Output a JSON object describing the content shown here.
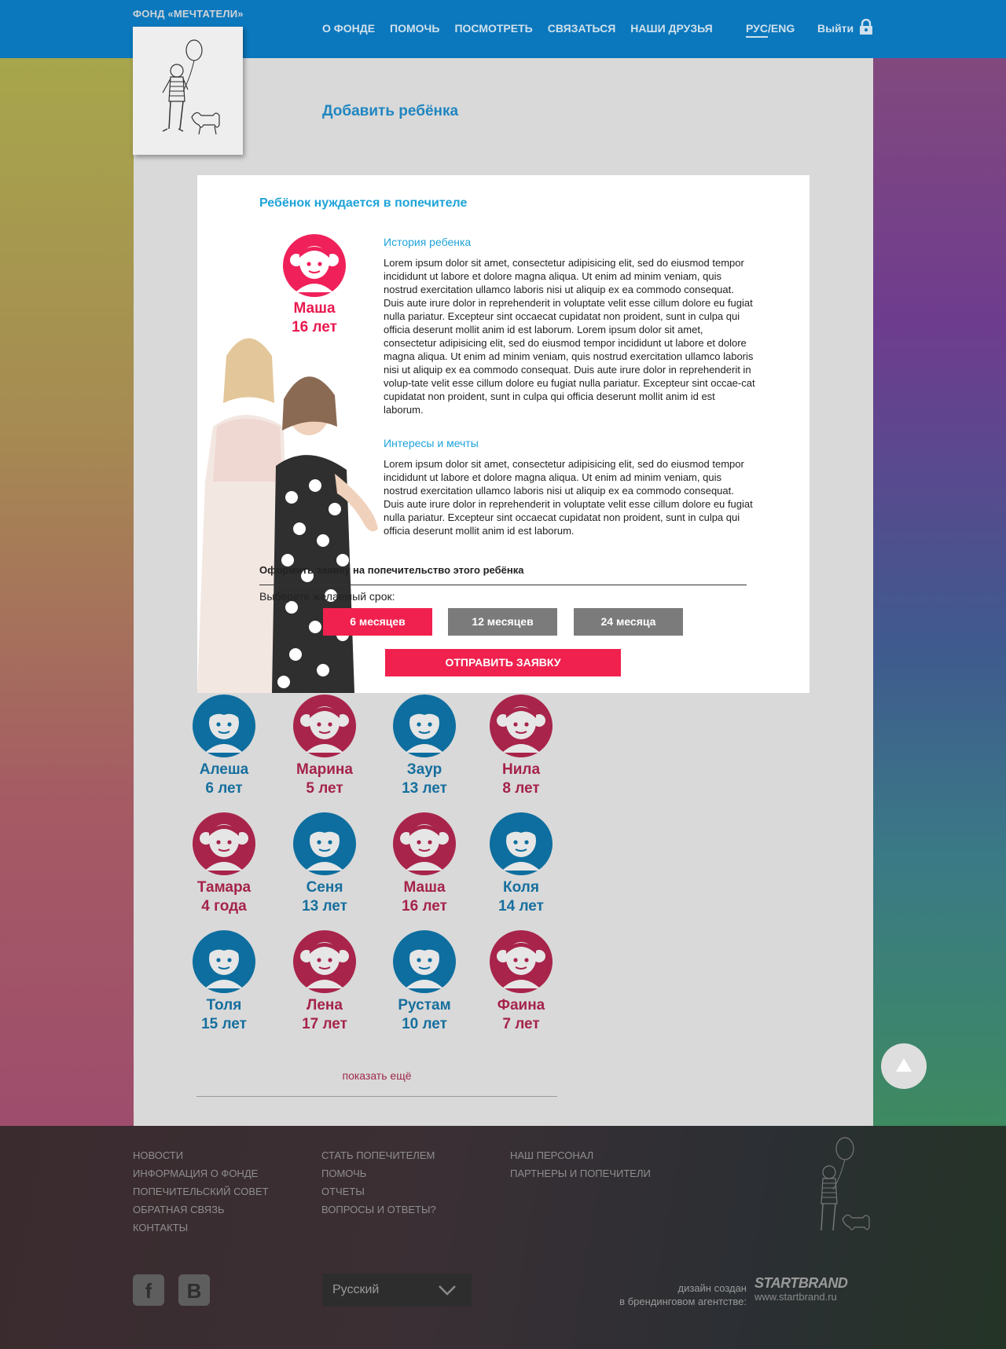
{
  "header": {
    "brand": "ФОНД «МЕЧТАТЕЛИ»",
    "nav": [
      "О ФОНДЕ",
      "ПОМОЧЬ",
      "ПОСМОТРЕТЬ",
      "СВЯЗАТЬСЯ",
      "НАШИ ДРУЗЬЯ"
    ],
    "lang_ru": "РУС",
    "lang_sep": "/",
    "lang_en": "ENG",
    "logout": "Выйти"
  },
  "page": {
    "title": "Добавить ребёнка"
  },
  "modal": {
    "title": "Ребёнок нуждается в попечителе",
    "child_name": "Маша",
    "child_age": "16 лет",
    "history_title": "История ребенка",
    "history_text": "Lorem ipsum dolor sit amet, consectetur adipisicing elit, sed do eiusmod tempor incididunt ut labore et dolore magna aliqua. Ut enim ad minim veniam, quis nostrud exercitation ullamco laboris nisi ut aliquip ex ea commodo consequat. Duis aute irure dolor in reprehenderit in voluptate velit esse cillum dolore eu fugiat nulla pariatur. Excepteur sint occaecat cupidatat non proident, sunt in culpa qui officia deserunt mollit anim id est laborum. Lorem ipsum dolor sit amet, consectetur adipisicing elit, sed do eiusmod tempor incididunt ut labore et dolore magna aliqua. Ut enim ad minim veniam, quis nostrud exercitation ullamco laboris nisi ut aliquip ex ea commodo consequat. Duis aute irure dolor in reprehenderit in volup-tate velit esse cillum dolore eu fugiat nulla pariatur. Excepteur sint occae-cat cupidatat non proident, sunt in culpa qui officia deserunt mollit anim id est laborum.",
    "dreams_title": "Интересы и мечты",
    "dreams_text": "Lorem ipsum dolor sit amet, consectetur adipisicing elit, sed do eiusmod tempor incididunt ut labore et dolore magna aliqua. Ut enim ad minim veniam, quis nostrud exercitation ullamco laboris nisi ut aliquip ex ea commodo consequat. Duis aute irure dolor in reprehenderit in voluptate velit esse cillum dolore eu fugiat nulla pariatur. Excepteur sint occaecat cupidatat non proident, sunt in culpa qui officia deserunt mollit anim id est laborum.",
    "apply_title": "Оформить заявку на попечительство этого ребёнка",
    "choose_label": "Выберете желаемый срок:",
    "terms": [
      "6 месяцев",
      "12 месяцев",
      "24 месяца"
    ],
    "selected_term": "6 месяцев",
    "submit": "ОТПРАВИТЬ ЗАЯВКУ"
  },
  "kids": [
    {
      "name": "Алеша",
      "age": "6 лет",
      "gender": "boy"
    },
    {
      "name": "Марина",
      "age": "5 лет",
      "gender": "girl"
    },
    {
      "name": "Заур",
      "age": "13 лет",
      "gender": "boy"
    },
    {
      "name": "Нила",
      "age": "8 лет",
      "gender": "girl"
    },
    {
      "name": "Тамара",
      "age": "4 года",
      "gender": "girl"
    },
    {
      "name": "Сеня",
      "age": "13 лет",
      "gender": "boy"
    },
    {
      "name": "Маша",
      "age": "16 лет",
      "gender": "girl"
    },
    {
      "name": "Коля",
      "age": "14 лет",
      "gender": "boy"
    },
    {
      "name": "Толя",
      "age": "15 лет",
      "gender": "boy"
    },
    {
      "name": "Лена",
      "age": "17 лет",
      "gender": "girl"
    },
    {
      "name": "Рустам",
      "age": "10 лет",
      "gender": "boy"
    },
    {
      "name": "Фаина",
      "age": "7 лет",
      "gender": "girl"
    }
  ],
  "show_more": "показать ещё",
  "footer": {
    "col1": [
      "НОВОСТИ",
      "ИНФОРМАЦИЯ О ФОНДЕ",
      "ПОПЕЧИТЕЛЬСКИЙ СОВЕТ",
      "ОБРАТНАЯ СВЯЗЬ",
      "КОНТАКТЫ"
    ],
    "col2": [
      "СТАТЬ ПОПЕЧИТЕЛЕМ",
      "ПОМОЧЬ",
      "ОТЧЕТЫ",
      "ВОПРОСЫ И ОТВЕТЫ?"
    ],
    "col3": [
      "НАШ ПЕРСОНАЛ",
      "ПАРТНЕРЫ И ПОПЕЧИТЕЛИ"
    ],
    "facebook": "f",
    "vk": "B",
    "language_select": "Русский",
    "credit_line1": "дизайн создан",
    "credit_line2": "в брендинговом агентстве:",
    "agency": "STARTBRAND",
    "agency_site": "www.startbrand.ru"
  },
  "colors": {
    "header_blue": "#0b78bd",
    "accent_pink": "#f0214e",
    "link_blue": "#1ea3d9",
    "boy_blue": "#0d6e9f",
    "girl_red": "#a8244a"
  },
  "icons": [
    "lock-icon",
    "arrow-up-icon",
    "chevron-down-icon",
    "facebook-icon",
    "vk-icon",
    "boy-avatar-icon",
    "girl-avatar-icon",
    "balloon-boy-logo"
  ]
}
